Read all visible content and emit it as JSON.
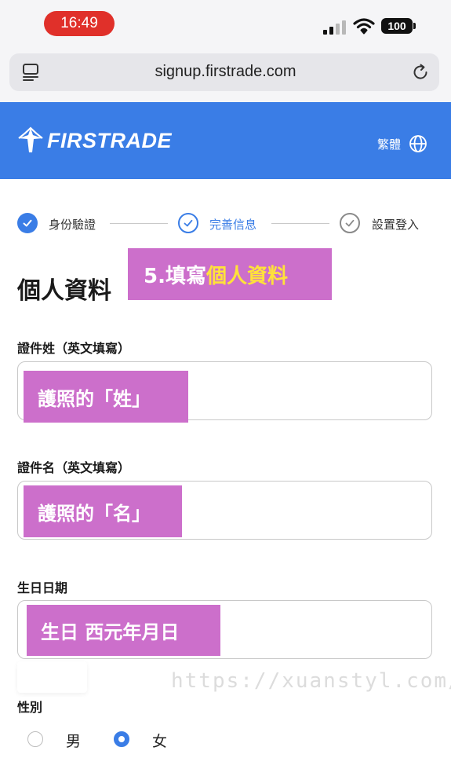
{
  "status_bar": {
    "time": "16:49",
    "battery": "100"
  },
  "browser": {
    "url": "signup.firstrade.com"
  },
  "header": {
    "brand": "FIRSTRADE",
    "language": "繁體"
  },
  "stepper": {
    "steps": [
      {
        "label": "身份驗證",
        "state": "done"
      },
      {
        "label": "完善信息",
        "state": "current"
      },
      {
        "label": "設置登入",
        "state": "pending"
      }
    ]
  },
  "page": {
    "title": "個人資料"
  },
  "annotation": {
    "title_prefix": "5.填寫",
    "title_highlight": "個人資料"
  },
  "form": {
    "last_name": {
      "label": "證件姓（英文填寫）",
      "annotation": "護照的「姓」"
    },
    "first_name": {
      "label": "證件名（英文填寫）",
      "annotation": "護照的「名」"
    },
    "birthday": {
      "label": "生日日期",
      "annotation": "生日 西元年月日"
    },
    "gender": {
      "label": "性別",
      "options": [
        {
          "label": "男",
          "selected": false
        },
        {
          "label": "女",
          "selected": true
        }
      ]
    }
  },
  "watermark": "https://xuanstyl.com/",
  "colors": {
    "brand_blue": "#3a7de6",
    "annotation_pink": "#cc6fcb",
    "annotation_yellow": "#ffe23a",
    "status_red": "#e0302a"
  }
}
